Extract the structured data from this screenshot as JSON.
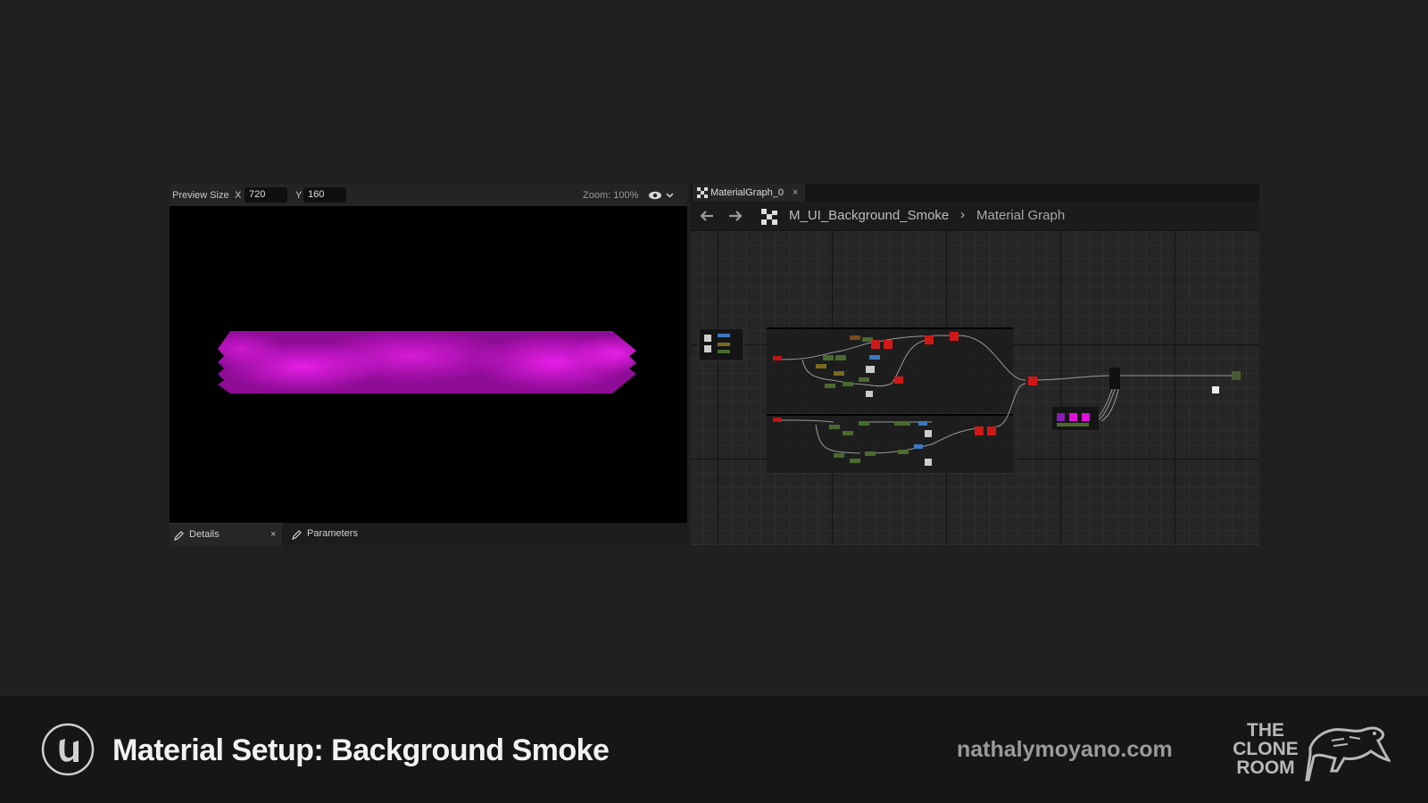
{
  "preview": {
    "size_label": "Preview Size",
    "x_label": "X",
    "x_value": "720",
    "y_label": "Y",
    "y_value": "160",
    "zoom": "Zoom: 100%",
    "tabs": [
      {
        "label": "Details",
        "close": "×"
      },
      {
        "label": "Parameters"
      }
    ]
  },
  "graph": {
    "tab_label": "MaterialGraph_0",
    "tab_close": "×",
    "breadcrumb": [
      "M_UI_Background_Smoke",
      "Material Graph"
    ],
    "breadcrumb_sep": "›"
  },
  "footer": {
    "title": "Material Setup: Background Smoke",
    "url": "nathalymoyano.com",
    "brand_lines": [
      "THE",
      "CLONE",
      "ROOM"
    ]
  },
  "colors": {
    "smoke": "#c215c8",
    "node_red": "#d01818",
    "node_magenta": "#e010d8",
    "node_purple": "#8a1ab8"
  }
}
